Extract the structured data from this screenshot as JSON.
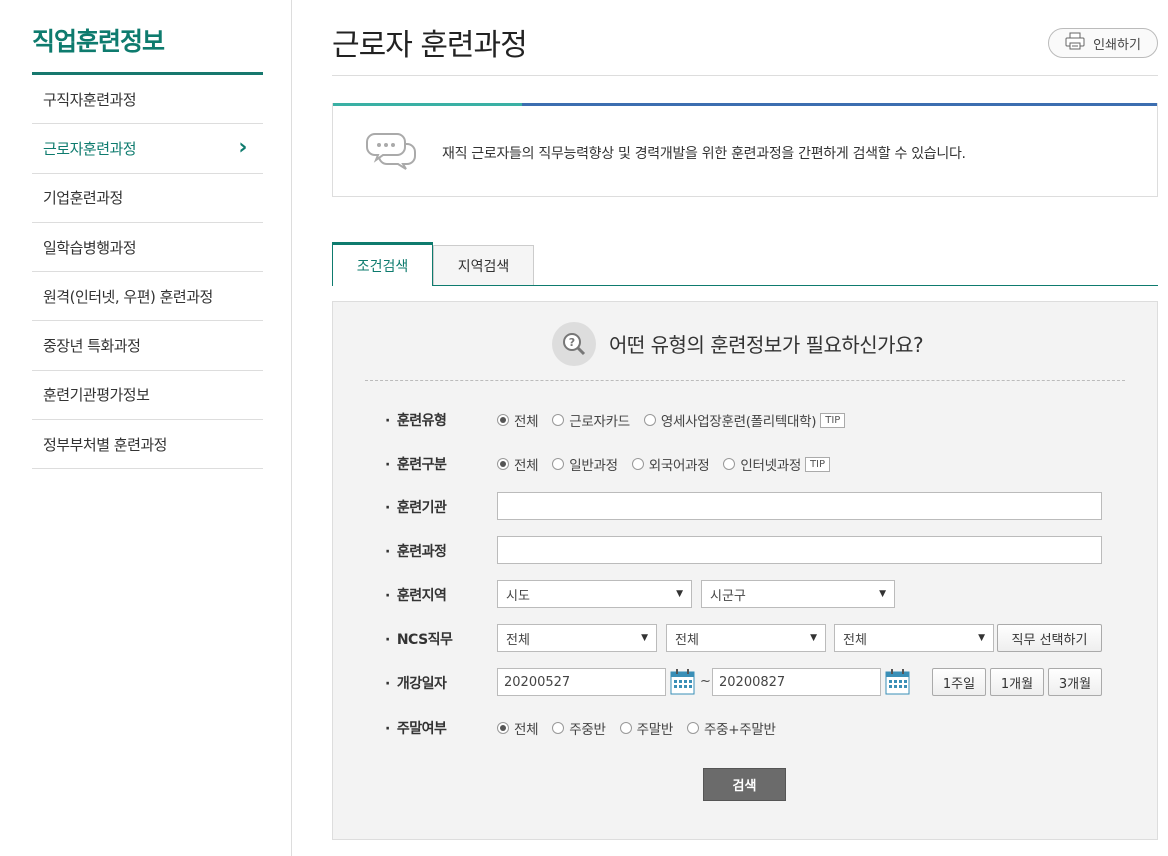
{
  "sidebar": {
    "title": "직업훈련정보",
    "items": [
      {
        "label": "구직자훈련과정",
        "active": false
      },
      {
        "label": "근로자훈련과정",
        "active": true
      },
      {
        "label": "기업훈련과정",
        "active": false
      },
      {
        "label": "일학습병행과정",
        "active": false
      },
      {
        "label": "원격(인터넷, 우편) 훈련과정",
        "active": false
      },
      {
        "label": "중장년 특화과정",
        "active": false
      },
      {
        "label": "훈련기관평가정보",
        "active": false
      },
      {
        "label": "정부부처별 훈련과정",
        "active": false
      }
    ]
  },
  "header": {
    "title": "근로자 훈련과정",
    "print_label": "인쇄하기"
  },
  "info": {
    "text": "재직 근로자들의 직무능력향상 및 경력개발을 위한 훈련과정을 간편하게 검색할 수 있습니다."
  },
  "tabs": [
    {
      "label": "조건검색",
      "active": true
    },
    {
      "label": "지역검색",
      "active": false
    }
  ],
  "search": {
    "question": "어떤 유형의 훈련정보가 필요하신가요?",
    "training_type": {
      "label": "훈련유형",
      "options": [
        "전체",
        "근로자카드",
        "영세사업장훈련(폴리텍대학)"
      ],
      "selected": "전체",
      "tip": "TIP"
    },
    "training_category": {
      "label": "훈련구분",
      "options": [
        "전체",
        "일반과정",
        "외국어과정",
        "인터넷과정"
      ],
      "selected": "전체",
      "tip": "TIP"
    },
    "institution": {
      "label": "훈련기관",
      "value": ""
    },
    "course": {
      "label": "훈련과정",
      "value": ""
    },
    "region": {
      "label": "훈련지역",
      "sido": "시도",
      "sigungu": "시군구"
    },
    "ncs": {
      "label": "NCS직무",
      "select1": "전체",
      "select2": "전체",
      "select3": "전체",
      "button": "직무 선택하기"
    },
    "date": {
      "label": "개강일자",
      "start": "20200527",
      "end": "20200827",
      "separator": "~",
      "btn_1w": "1주일",
      "btn_1m": "1개월",
      "btn_3m": "3개월"
    },
    "weekend": {
      "label": "주말여부",
      "options": [
        "전체",
        "주중반",
        "주말반",
        "주중+주말반"
      ],
      "selected": "전체"
    },
    "submit": "검색"
  }
}
